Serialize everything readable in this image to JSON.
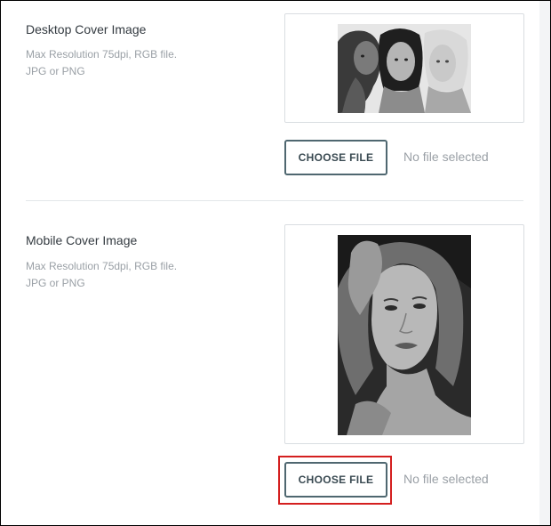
{
  "desktop": {
    "title": "Desktop Cover Image",
    "desc_line1": "Max Resolution 75dpi, RGB file.",
    "desc_line2": "JPG or PNG",
    "choose_label": "CHOOSE FILE",
    "file_status": "No file selected"
  },
  "mobile": {
    "title": "Mobile Cover Image",
    "desc_line1": "Max Resolution 75dpi, RGB file.",
    "desc_line2": "JPG or PNG",
    "choose_label": "CHOOSE FILE",
    "file_status": "No file selected"
  },
  "colors": {
    "button_border": "#4f6770",
    "highlight": "#d41f1f",
    "muted_text": "#9aa0a6"
  }
}
